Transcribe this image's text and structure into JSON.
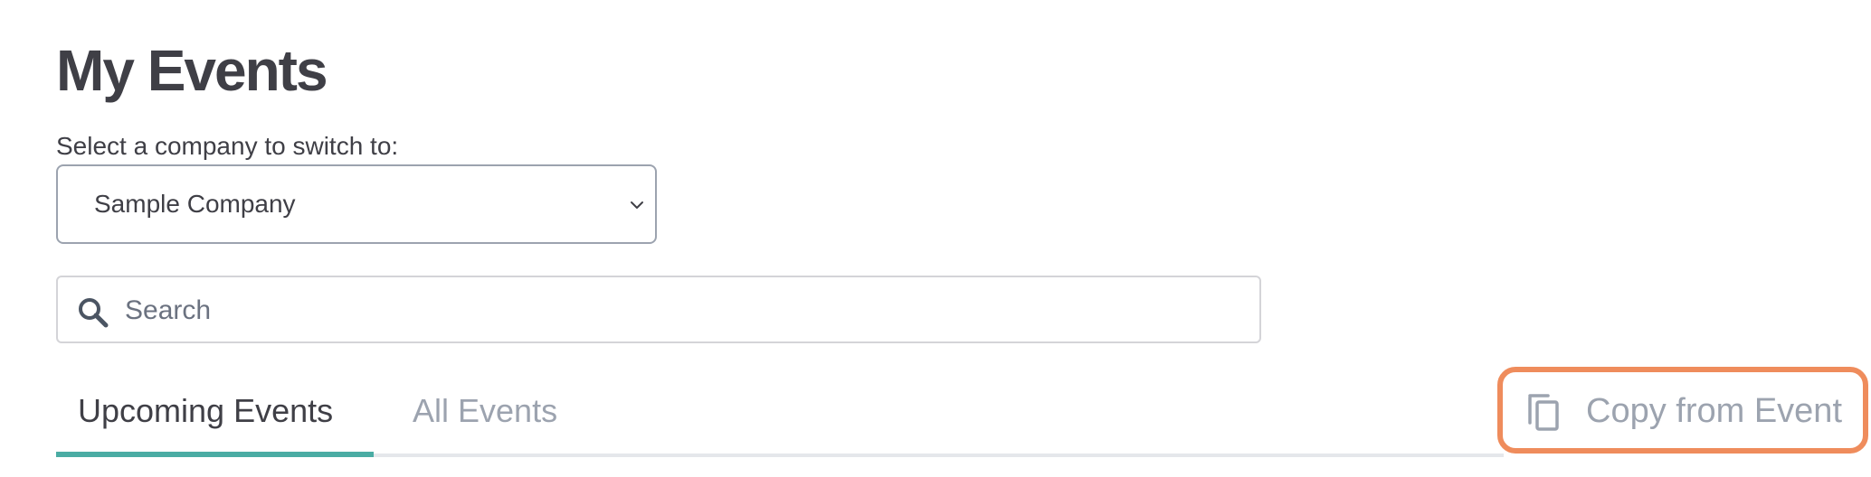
{
  "page": {
    "title": "My Events"
  },
  "company_switcher": {
    "label": "Select a company to switch to:",
    "selected": "Sample Company"
  },
  "search": {
    "placeholder": "Search",
    "value": ""
  },
  "tabs": [
    {
      "label": "Upcoming Events",
      "active": true
    },
    {
      "label": "All Events",
      "active": false
    }
  ],
  "actions": {
    "copy_from_event_label": "Copy from Event"
  },
  "colors": {
    "accent": "#4aaca4",
    "highlight": "#ef8c5c",
    "text": "#3f3f46",
    "muted": "#9ca3af"
  },
  "icons": {
    "search": "search-icon",
    "copy": "copy-icon",
    "select_chevron": "chevron-down-icon"
  }
}
